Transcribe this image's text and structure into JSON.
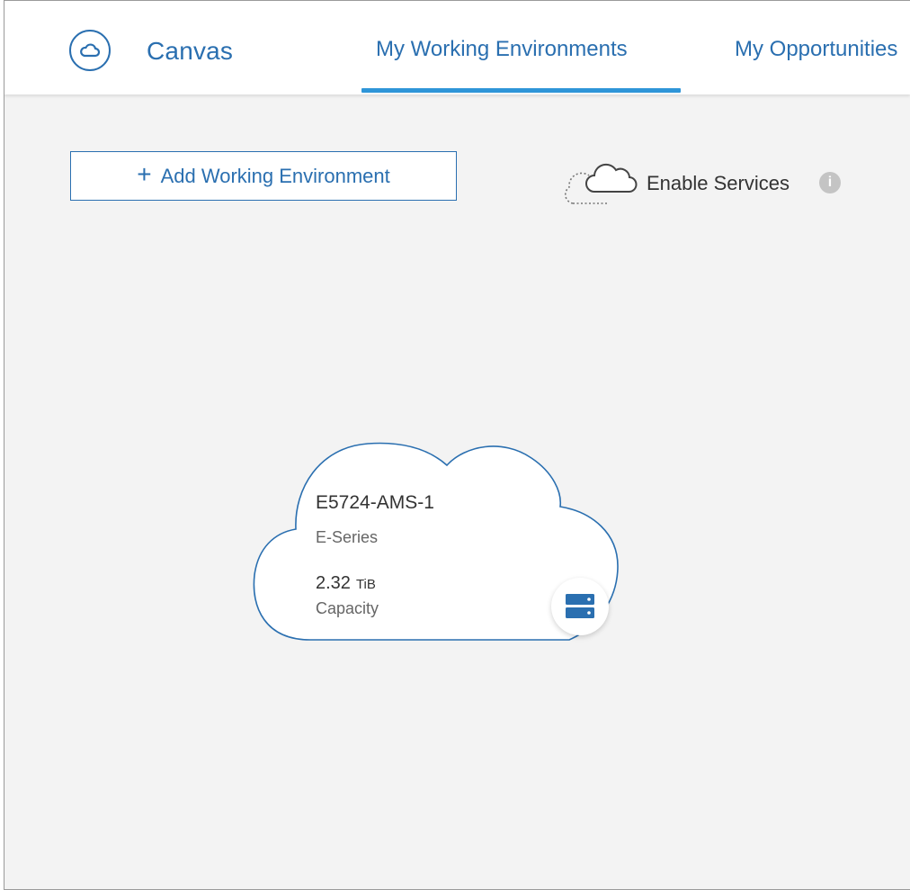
{
  "header": {
    "app_title": "Canvas",
    "tabs": [
      {
        "label": "My Working Environments",
        "active": true
      },
      {
        "label": "My Opportunities",
        "active": false
      }
    ]
  },
  "toolbar": {
    "add_button_icon": "+",
    "add_button_label": "Add Working Environment",
    "enable_services_label": "Enable Services",
    "info_icon_glyph": "i"
  },
  "working_environment": {
    "name": "E5724-AMS-1",
    "type": "E-Series",
    "capacity_value": "2.32",
    "capacity_unit": "TiB",
    "capacity_label": "Capacity",
    "icon": "storage-server-icon"
  },
  "colors": {
    "accent": "#2a6fb0",
    "tab_underline": "#2e95d8",
    "canvas_background": "#f3f3f3"
  }
}
